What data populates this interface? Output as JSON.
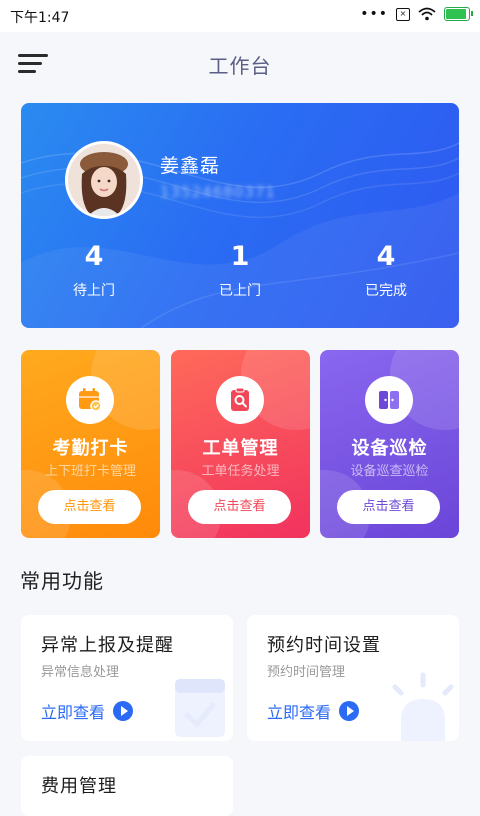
{
  "status": {
    "time": "下午1:47",
    "dots": "•••",
    "sim": "×"
  },
  "header": {
    "title": "工作台"
  },
  "profile": {
    "name": "姜鑫磊",
    "phone": "13524680371",
    "stats": [
      {
        "value": "4",
        "label": "待上门"
      },
      {
        "value": "1",
        "label": "已上门"
      },
      {
        "value": "4",
        "label": "已完成"
      }
    ]
  },
  "tiles": [
    {
      "title": "考勤打卡",
      "subtitle": "上下班打卡管理",
      "button": "点击查看",
      "icon": "calendar-icon",
      "color_from": "#ffaa1e",
      "color_to": "#ff8a0a",
      "accent": "#ff9408"
    },
    {
      "title": "工单管理",
      "subtitle": "工单任务处理",
      "button": "点击查看",
      "icon": "search-clipboard-icon",
      "color_from": "#ff6a5a",
      "color_to": "#f1325e",
      "accent": "#f04858"
    },
    {
      "title": "设备巡检",
      "subtitle": "设备巡查巡检",
      "button": "点击查看",
      "icon": "device-icon",
      "color_from": "#8a67ef",
      "color_to": "#6a45d8",
      "accent": "#6c49d6"
    }
  ],
  "section": {
    "title": "常用功能"
  },
  "functions": [
    {
      "title": "异常上报及提醒",
      "subtitle": "异常信息处理",
      "link": "立即查看"
    },
    {
      "title": "预约时间设置",
      "subtitle": "预约时间管理",
      "link": "立即查看"
    },
    {
      "title": "费用管理"
    }
  ]
}
